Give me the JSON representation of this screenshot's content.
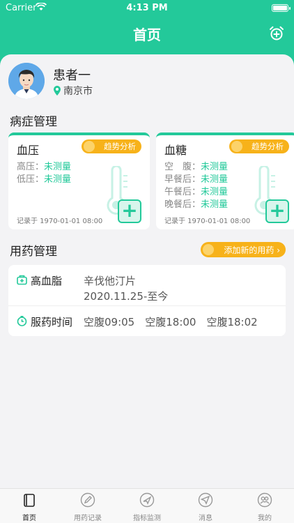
{
  "status_bar": {
    "carrier": "Carrier",
    "time": "4:13 PM"
  },
  "nav": {
    "title": "首页",
    "alarm_icon": "alarm-add-icon"
  },
  "patient": {
    "name": "患者一",
    "city": "南京市"
  },
  "symptom_section": {
    "title": "病症管理",
    "cards": [
      {
        "title": "血压",
        "trend_label": "趋势分析",
        "rows": [
          {
            "label": "高压：",
            "value": "未测量"
          },
          {
            "label": "低压：",
            "value": "未测量"
          }
        ],
        "record": "记录于 1970-01-01 08:00"
      },
      {
        "title": "血糖",
        "trend_label": "趋势分析",
        "rows": [
          {
            "label": "空　腹：",
            "value": "未测量"
          },
          {
            "label": "早餐后：",
            "value": "未测量"
          },
          {
            "label": "午餐后：",
            "value": "未测量"
          },
          {
            "label": "晚餐后：",
            "value": "未测量"
          }
        ],
        "record": "记录于 1970-01-01 08:00"
      }
    ]
  },
  "medication_section": {
    "title": "用药管理",
    "add_button": "添加新的用药 ›",
    "disease_label": "高血脂",
    "drug_name": "辛伐他汀片",
    "drug_period": "2020.11.25-至今",
    "time_label": "服药时间",
    "times": "空腹09:05　空腹18:00　空腹18:02"
  },
  "tabs": [
    {
      "label": "首页",
      "icon": "home-icon",
      "active": true
    },
    {
      "label": "用药记录",
      "icon": "pen-icon",
      "active": false
    },
    {
      "label": "指标监测",
      "icon": "monitor-icon",
      "active": false
    },
    {
      "label": "消息",
      "icon": "message-icon",
      "active": false
    },
    {
      "label": "我的",
      "icon": "profile-icon",
      "active": false
    }
  ],
  "colors": {
    "primary": "#23c99a",
    "accent": "#f7b21a",
    "background": "#f3f3f5"
  }
}
